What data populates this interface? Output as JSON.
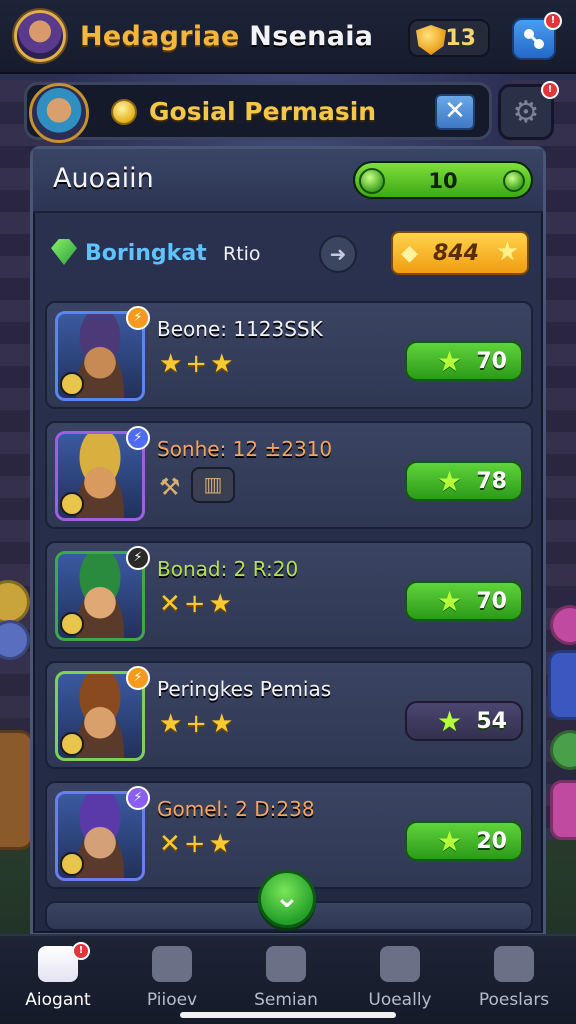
{
  "header": {
    "title_part1": "Hedagriae",
    "title_part2": "Nsenaia",
    "gem_count": "13"
  },
  "search": {
    "text": "Gosial Permasin"
  },
  "panel": {
    "title": "Auoaiin",
    "progress_value": "10",
    "filter_label": "Boringkat",
    "filter_sub": "Rtio",
    "gold_value": "844"
  },
  "rows": [
    {
      "name": "Beone: 1123SSK",
      "name_color": "#f2f2f6",
      "score": "70",
      "stars": "★+★",
      "frame": "#5a86f0",
      "skin": "#c78a55",
      "hair": "#4c3a78",
      "corner_color": "#f59a1c"
    },
    {
      "name": "Sonhe: 12 ±2310",
      "name_color": "#f7a55a",
      "score": "78",
      "stars": "",
      "frame": "#a05ee0",
      "skin": "#d89a5e",
      "hair": "#d9b040",
      "corner_color": "#4f6cf0"
    },
    {
      "name": "Bonad: 2 R:20",
      "name_color": "#b4e04a",
      "score": "70",
      "stars": "✕+★",
      "frame": "#3ea84a",
      "skin": "#e0a874",
      "hair": "#2a8a3e",
      "corner_color": "#2a2a2a"
    },
    {
      "name": "Peringkes Pemias",
      "name_color": "#f2f2f6",
      "score": "54",
      "stars": "★+★",
      "frame": "#7ed05a",
      "skin": "#d9a06c",
      "hair": "#8a4a20",
      "corner_color": "#f59a1c"
    },
    {
      "name": "Gomel: 2 D:238",
      "name_color": "#f7a55a",
      "score": "20",
      "stars": "✕+★",
      "frame": "#6a7ef0",
      "skin": "#d4a078",
      "hair": "#5a3aa8",
      "corner_color": "#8a5ef0"
    }
  ],
  "nav": [
    {
      "label": "Aiogant",
      "icon": "home-icon",
      "active": true
    },
    {
      "label": "Piioev",
      "icon": "tools-icon",
      "active": false
    },
    {
      "label": "Semian",
      "icon": "list-icon",
      "active": false
    },
    {
      "label": "Uoeally",
      "icon": "gamepad-icon",
      "active": false
    },
    {
      "label": "Poeslars",
      "icon": "profile-icon",
      "active": false
    }
  ],
  "colors": {
    "accent_gold": "#f4b73c",
    "accent_green": "#3da815",
    "accent_blue": "#5fc3ff",
    "panel_bg": "#2a3250"
  }
}
